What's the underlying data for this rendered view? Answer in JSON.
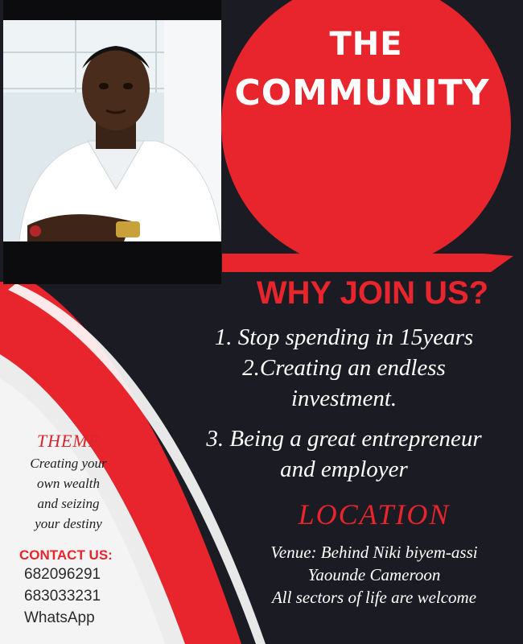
{
  "title": {
    "line1": "THE",
    "line2": "COMMUNITY"
  },
  "why": {
    "heading": "WHY JOIN US?",
    "reasons": [
      "1. Stop spending in 15years",
      "2.Creating an endless",
      "investment.",
      "3. Being a great entrepreneur",
      "and employer"
    ]
  },
  "location": {
    "heading": "LOCATION",
    "lines": [
      "Venue: Behind Niki biyem-assi",
      "Yaounde Cameroon",
      "All sectors of life are welcome"
    ]
  },
  "theme": {
    "heading": "THEME",
    "lines": [
      "Creating your",
      "own wealth",
      "and seizing",
      "your destiny"
    ]
  },
  "contact": {
    "heading": "CONTACT US:",
    "lines": [
      "682096291",
      "683033231",
      "WhatsApp"
    ]
  },
  "colors": {
    "background": "#1b1c23",
    "accent_red": "#e8242c",
    "white": "#ffffff",
    "light_panel": "#ececec"
  }
}
